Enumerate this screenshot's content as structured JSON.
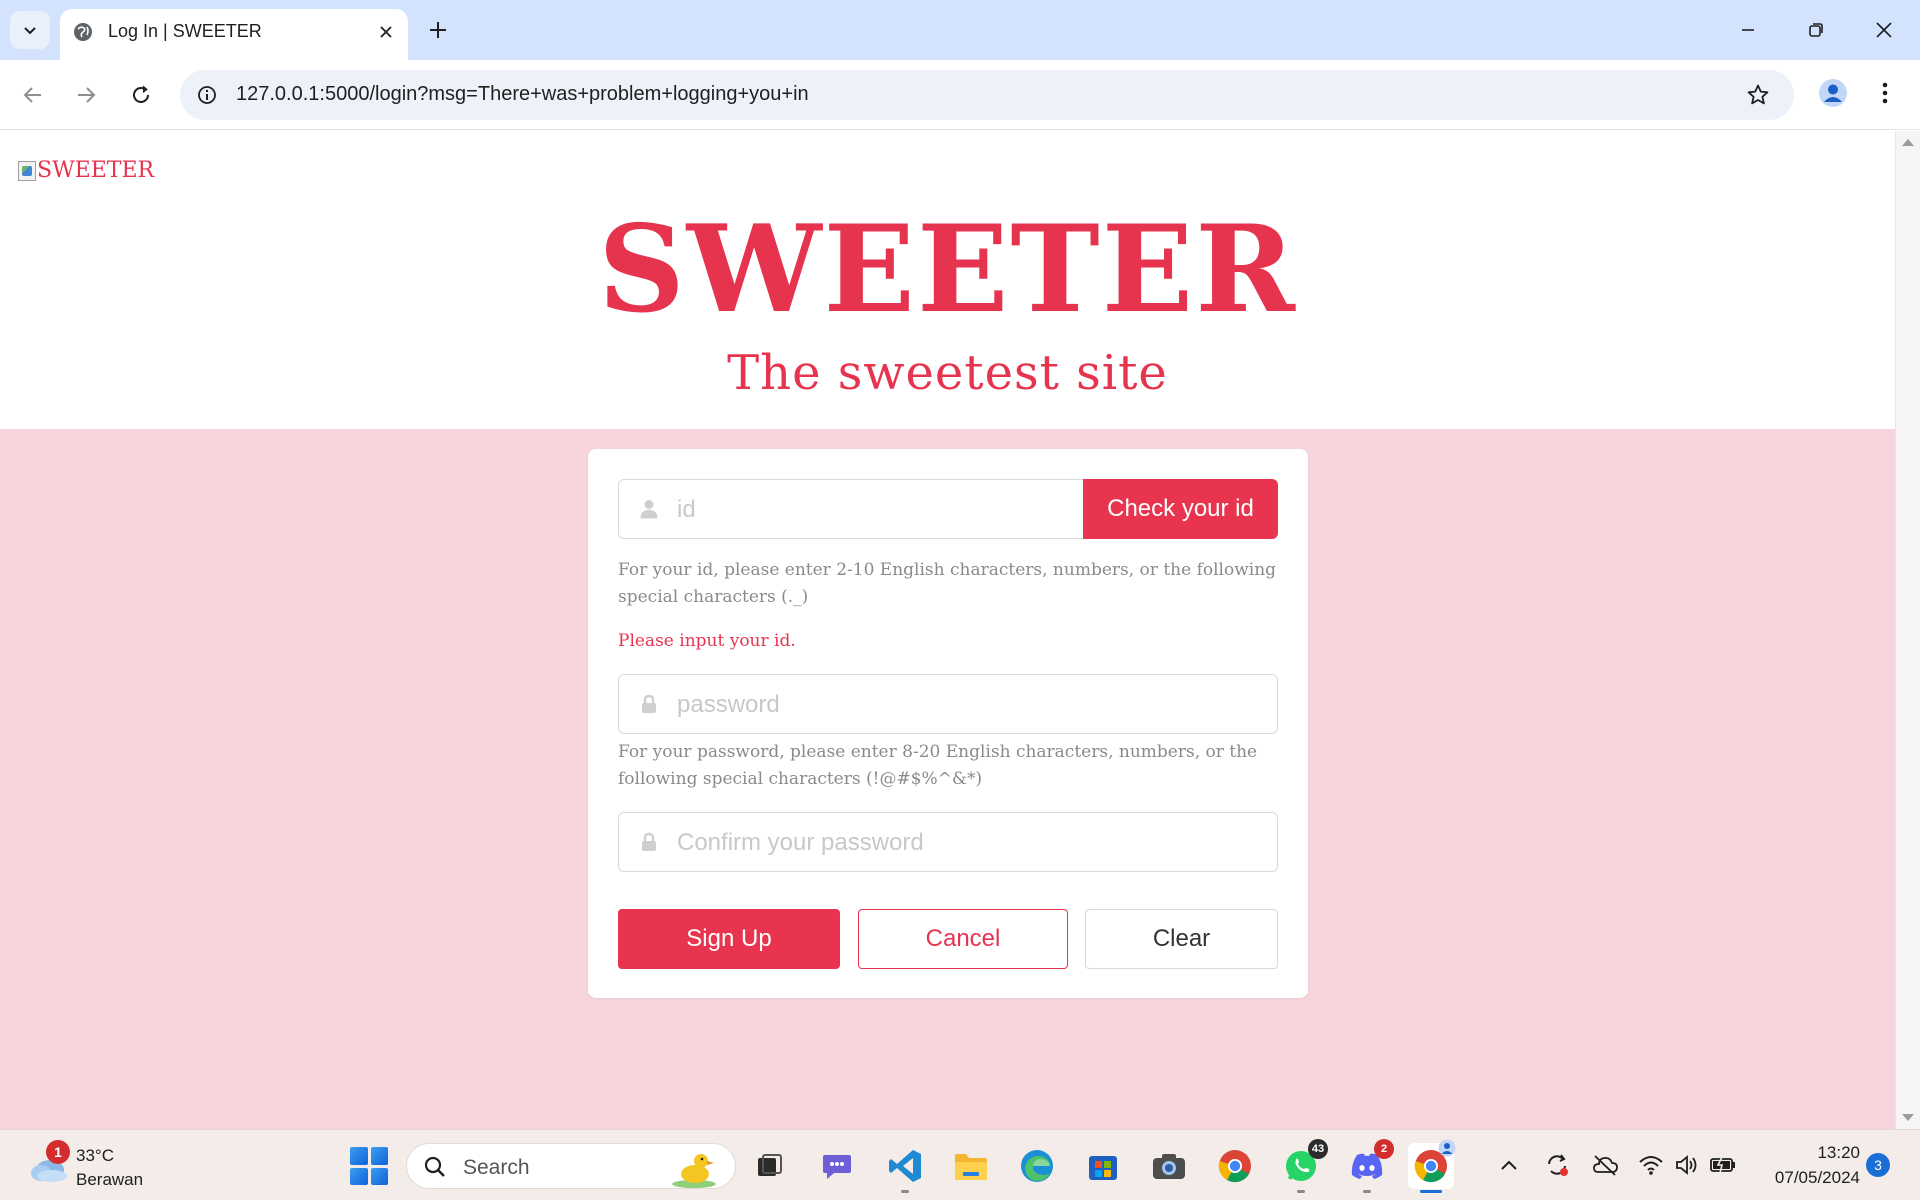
{
  "browser": {
    "tab_title": "Log In | SWEETER",
    "url": "127.0.0.1:5000/login?msg=There+was+problem+logging+you+in"
  },
  "page": {
    "logo_alt": "SWEETER",
    "site_title": "SWEETER",
    "site_subtitle": "The sweetest site",
    "id_field": {
      "placeholder": "id",
      "value": ""
    },
    "check_button": "Check your id",
    "id_hint": "For your id, please enter 2-10 English characters, numbers, or the following special characters (._)",
    "id_error": "Please input your id.",
    "password_field": {
      "placeholder": "password",
      "value": ""
    },
    "password_hint": "For your password, please enter 8-20 English characters, numbers, or the following special characters (!@#$%^&*)",
    "confirm_field": {
      "placeholder": "Confirm your password",
      "value": ""
    },
    "buttons": {
      "signup": "Sign Up",
      "cancel": "Cancel",
      "clear": "Clear"
    }
  },
  "colors": {
    "accent": "#e8344f",
    "pink_background": "#f8d5dc",
    "tabstrip": "#d3e3fd"
  },
  "taskbar": {
    "weather": {
      "badge": "1",
      "temp": "33°C",
      "desc": "Berawan"
    },
    "search_label": "Search",
    "apps": [
      {
        "name": "task-view",
        "icon": "task-view-icon"
      },
      {
        "name": "teams",
        "icon": "teams-icon"
      },
      {
        "name": "vscode",
        "icon": "vscode-icon"
      },
      {
        "name": "file-explorer",
        "icon": "folder-icon"
      },
      {
        "name": "edge",
        "icon": "edge-icon"
      },
      {
        "name": "store",
        "icon": "store-icon"
      },
      {
        "name": "camera",
        "icon": "camera-icon"
      },
      {
        "name": "chrome",
        "icon": "chrome-icon"
      },
      {
        "name": "whatsapp",
        "icon": "whatsapp-icon",
        "badge": "43"
      },
      {
        "name": "discord",
        "icon": "discord-icon",
        "badge": "2"
      },
      {
        "name": "chrome-profile",
        "icon": "chrome-icon"
      }
    ],
    "clock": {
      "time": "13:20",
      "date": "07/05/2024"
    },
    "notifications": "3"
  }
}
